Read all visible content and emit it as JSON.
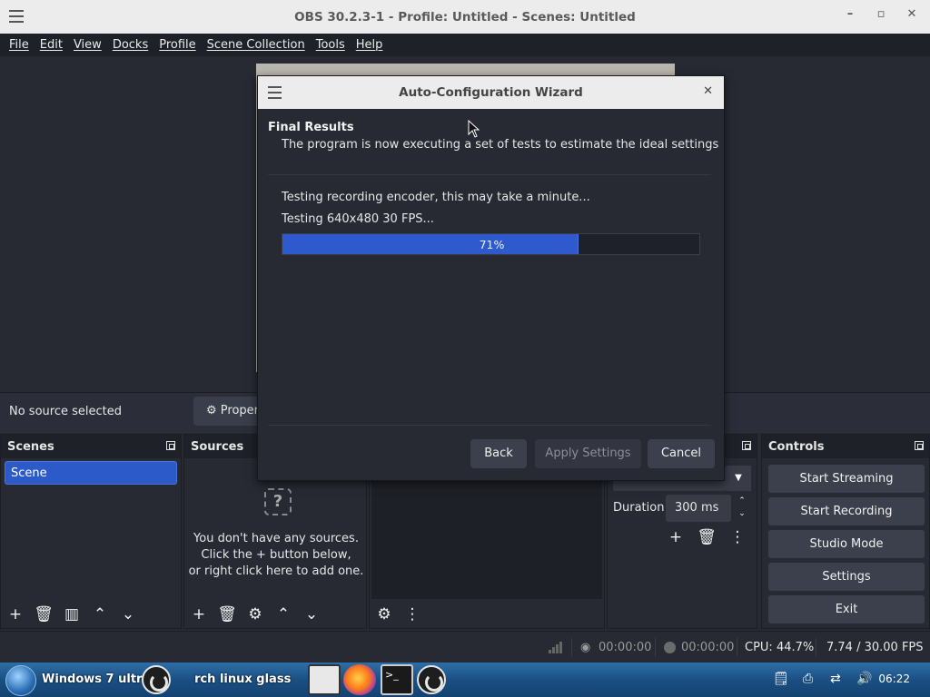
{
  "window": {
    "title": "OBS 30.2.3-1 - Profile: Untitled - Scenes: Untitled",
    "minimize": "–",
    "maximize": "▫",
    "close": "✕"
  },
  "menu": [
    "File",
    "Edit",
    "View",
    "Docks",
    "Profile",
    "Scene Collection",
    "Tools",
    "Help"
  ],
  "source_toolbar": {
    "status": "No source selected",
    "properties_label": "Proper"
  },
  "scenes": {
    "title": "Scenes",
    "items": [
      "Scene"
    ]
  },
  "sources": {
    "title": "Sources",
    "empty_line1": "You don't have any sources.",
    "empty_line2": "Click the + button below,",
    "empty_line3": "or right click here to add one."
  },
  "transitions": {
    "duration_label": "Duration",
    "duration_value": "300 ms"
  },
  "controls": {
    "title": "Controls",
    "buttons": [
      "Start Streaming",
      "Start Recording",
      "Studio Mode",
      "Settings",
      "Exit"
    ]
  },
  "status": {
    "stream_time": "00:00:00",
    "record_time": "00:00:00",
    "cpu": "CPU: 44.7%",
    "fps": "7.74 / 30.00 FPS"
  },
  "wizard": {
    "title": "Auto-Configuration Wizard",
    "heading": "Final Results",
    "subheading": "The program is now executing a set of tests to estimate the ideal settings",
    "message1": "Testing recording encoder, this may take a minute...",
    "message2": "Testing 640x480 30 FPS...",
    "progress_percent": 71,
    "progress_label": "71%",
    "back_label": "Back",
    "apply_label": "Apply Settings",
    "cancel_label": "Cancel"
  },
  "taskbar": {
    "window_title": "Windows 7 ultra L",
    "window_title_tail": "rch linux glass",
    "clock": "06:22"
  }
}
